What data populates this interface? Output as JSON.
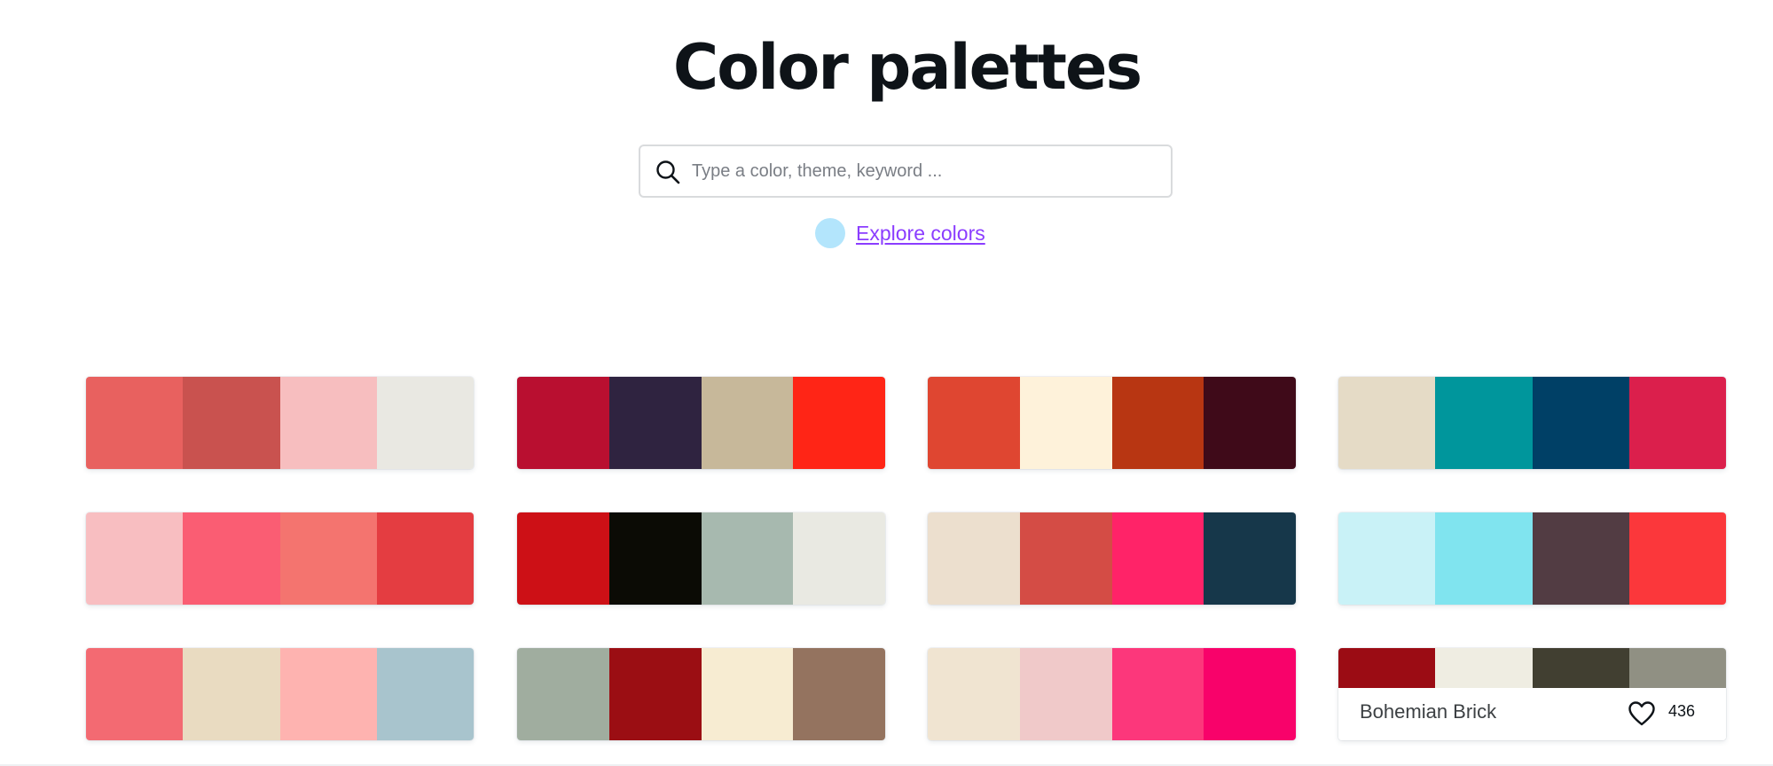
{
  "header": {
    "title": "Color palettes"
  },
  "search": {
    "placeholder": "Type a color, theme, keyword ..."
  },
  "explore": {
    "label": "Explore colors",
    "dot_color": "#b3e5fc",
    "link_color": "#8b3dff"
  },
  "palettes": [
    [
      "#e8615f",
      "#c9524f",
      "#f7bebf",
      "#e9e8e2"
    ],
    [
      "#b90f30",
      "#2f2340",
      "#c7b89a",
      "#ff2516"
    ],
    [
      "#df4631",
      "#fef2da",
      "#b83612",
      "#3f0a19"
    ],
    [
      "#e5dbc6",
      "#00969c",
      "#004066",
      "#db1f4c"
    ],
    [
      "#f8bec1",
      "#fa5d73",
      "#f4746f",
      "#e43d41"
    ],
    [
      "#cd1016",
      "#0b0b05",
      "#a7b9af",
      "#e9e9e2"
    ],
    [
      "#ecdfce",
      "#d44c45",
      "#ff2368",
      "#16374a"
    ],
    [
      "#c9f2f7",
      "#80e4ef",
      "#523c43",
      "#fb373b"
    ],
    [
      "#f36a72",
      "#e9dbc1",
      "#feb3b0",
      "#a8c4cd"
    ],
    [
      "#a0ad9f",
      "#9b0e13",
      "#f7ecd2",
      "#94735f"
    ],
    [
      "#f0e4d1",
      "#f0c9c9",
      "#fc377b",
      "#f8026a"
    ],
    [
      "#9b0c14",
      "#efede2",
      "#413f31",
      "#909083"
    ]
  ],
  "featured_palette": {
    "name": "Bohemian Brick",
    "likes": "436"
  }
}
